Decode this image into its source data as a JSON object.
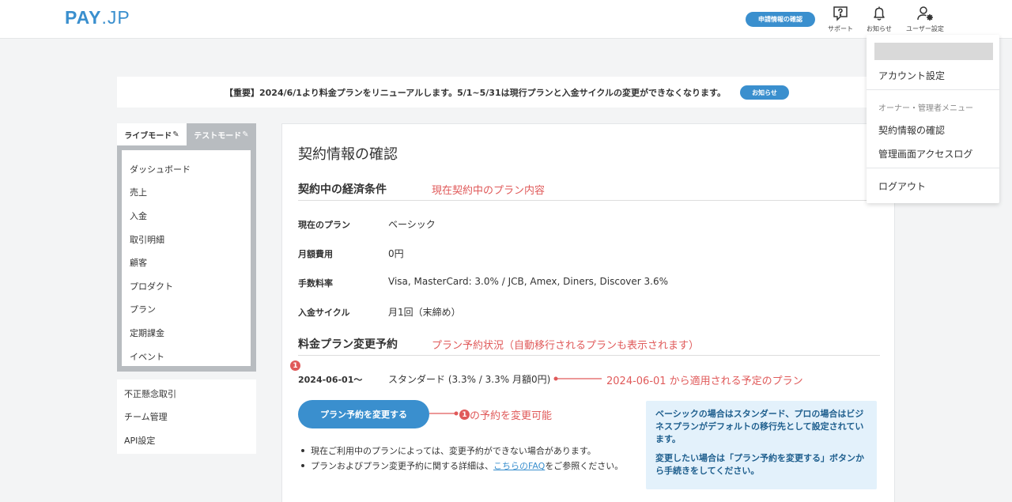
{
  "header": {
    "logo_main": "PAY",
    "logo_sub": ".JP",
    "apply_button": "申請情報の確認",
    "support_label": "サポート",
    "notifications_label": "お知らせ",
    "user_settings_label": "ユーザー設定"
  },
  "notice": {
    "text": "【重要】2024/6/1より料金プランをリニューアルします。5/1~5/31は現行プランと入金サイクルの変更ができなくなります。",
    "button": "お知らせ"
  },
  "mode_tabs": {
    "live": "ライブモード",
    "test": "テストモード",
    "pen_glyph": "✎"
  },
  "sidebar": {
    "items": [
      {
        "label": "ダッシュボード"
      },
      {
        "label": "売上"
      },
      {
        "label": "入金"
      },
      {
        "label": "取引明細"
      },
      {
        "label": "顧客"
      },
      {
        "label": "プロダクト"
      },
      {
        "label": "プラン"
      },
      {
        "label": "定期課金"
      },
      {
        "label": "イベント"
      }
    ],
    "secondary": [
      {
        "label": "不正懸念取引"
      },
      {
        "label": "チーム管理"
      },
      {
        "label": "API設定"
      }
    ]
  },
  "main": {
    "title": "契約情報の確認",
    "section1_title": "契約中の経済条件",
    "section1_annotation": "現在契約中のプラン内容",
    "rows": [
      {
        "label": "現在のプラン",
        "value": "ベーシック"
      },
      {
        "label": "月額費用",
        "value": "0円"
      },
      {
        "label": "手数料率",
        "value": "Visa, MasterCard: 3.0% / JCB, Amex, Diners, Discover 3.6%"
      },
      {
        "label": "入金サイクル",
        "value": "月1回（末締め）"
      }
    ],
    "section2_title": "料金プラン変更予約",
    "section2_annotation": "プラン予約状況（自動移行されるプランも表示されます）",
    "badge": "1",
    "reservation_date": "2024-06-01～",
    "reservation_value": "スタンダード (3.3% / 3.3% 月額0円)",
    "reservation_annotation": "2024-06-01 から適用される予定のプラン",
    "change_button": "プラン予約を変更する",
    "change_annotation": "の予約を変更可能",
    "bullet1": "現在ご利用中のプランによっては、変更予約ができない場合があります。",
    "bullet2_before": "プランおよびプラン変更予約に関する詳細は、",
    "bullet2_link": "こちらのFAQ",
    "bullet2_after": "をご参照ください。",
    "info_p1": "ベーシックの場合はスタンダード、プロの場合はビジネスプランがデフォルトの移行先として設定されています。",
    "info_p2": "変更したい場合は「プラン予約を変更する」ボタンから手続きをしてください。"
  },
  "dropdown": {
    "account_settings": "アカウント設定",
    "owner_menu_heading": "オーナー・管理者メニュー",
    "contract_info": "契約情報の確認",
    "access_log": "管理画面アクセスログ",
    "logout": "ログアウト"
  },
  "colors": {
    "accent": "#3a8fce",
    "annotation": "#e05a5a",
    "info_bg": "#e3f1fb"
  }
}
